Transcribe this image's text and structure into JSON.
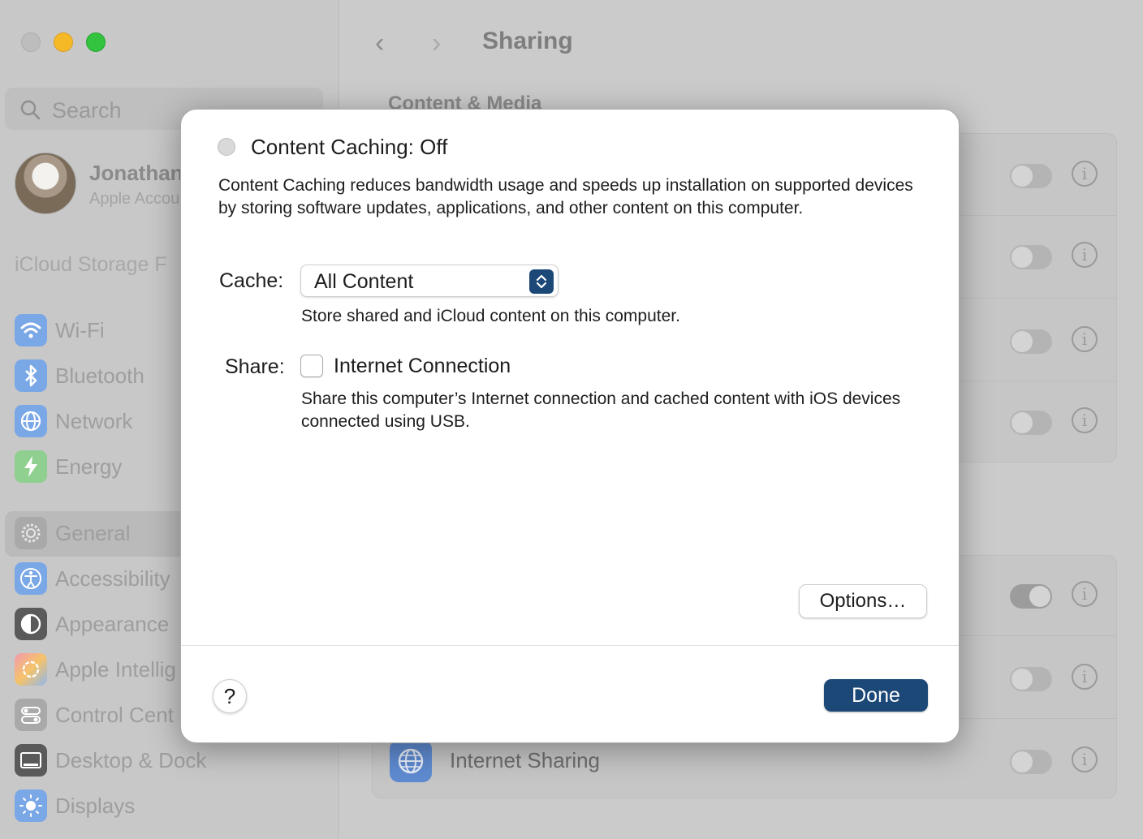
{
  "window": {
    "sidebar": {
      "search_placeholder": "Search",
      "profile": {
        "name": "Jonathan",
        "subtitle": "Apple Account"
      },
      "icloud_notice": "iCloud Storage F",
      "items": [
        {
          "label": "Wi-Fi",
          "icon": "wifi-icon",
          "color": "#3b82f6"
        },
        {
          "label": "Bluetooth",
          "icon": "bluetooth-icon",
          "color": "#3b82f6"
        },
        {
          "label": "Network",
          "icon": "globe-icon",
          "color": "#3b82f6"
        },
        {
          "label": "Energy",
          "icon": "bolt-icon",
          "color": "#34c759"
        },
        {
          "label": "General",
          "icon": "gear-icon",
          "color": "#8e8e93",
          "selected": true
        },
        {
          "label": "Accessibility",
          "icon": "accessibility-icon",
          "color": "#3b82f6"
        },
        {
          "label": "Appearance",
          "icon": "appearance-icon",
          "color": "#1c1c1e"
        },
        {
          "label": "Apple Intellig",
          "icon": "apple-intelligence-icon",
          "color": "#ff6b6b"
        },
        {
          "label": "Control Cent",
          "icon": "control-center-icon",
          "color": "#8e8e93"
        },
        {
          "label": "Desktop & Dock",
          "icon": "dock-icon",
          "color": "#1c1c1e"
        },
        {
          "label": "Displays",
          "icon": "sun-icon",
          "color": "#3b82f6"
        }
      ]
    },
    "header": {
      "title": "Sharing",
      "back": "‹",
      "forward": "›"
    },
    "content": {
      "section_title": "Content & Media",
      "visible_row_label": "Internet Sharing",
      "info_glyph": "i"
    }
  },
  "dialog": {
    "status_title": "Content Caching: Off",
    "description": "Content Caching reduces bandwidth usage and speeds up installation on supported devices by storing software updates, applications, and other content on this computer.",
    "cache": {
      "label": "Cache:",
      "selected": "All Content",
      "hint": "Store shared and iCloud content on this computer."
    },
    "share": {
      "label": "Share:",
      "option": "Internet Connection",
      "checked": false,
      "hint": "Share this computer’s Internet connection and cached content with iOS devices connected using USB."
    },
    "options_button": "Options…",
    "help_button": "?",
    "done_button": "Done",
    "accent_color": "#1c4877"
  }
}
